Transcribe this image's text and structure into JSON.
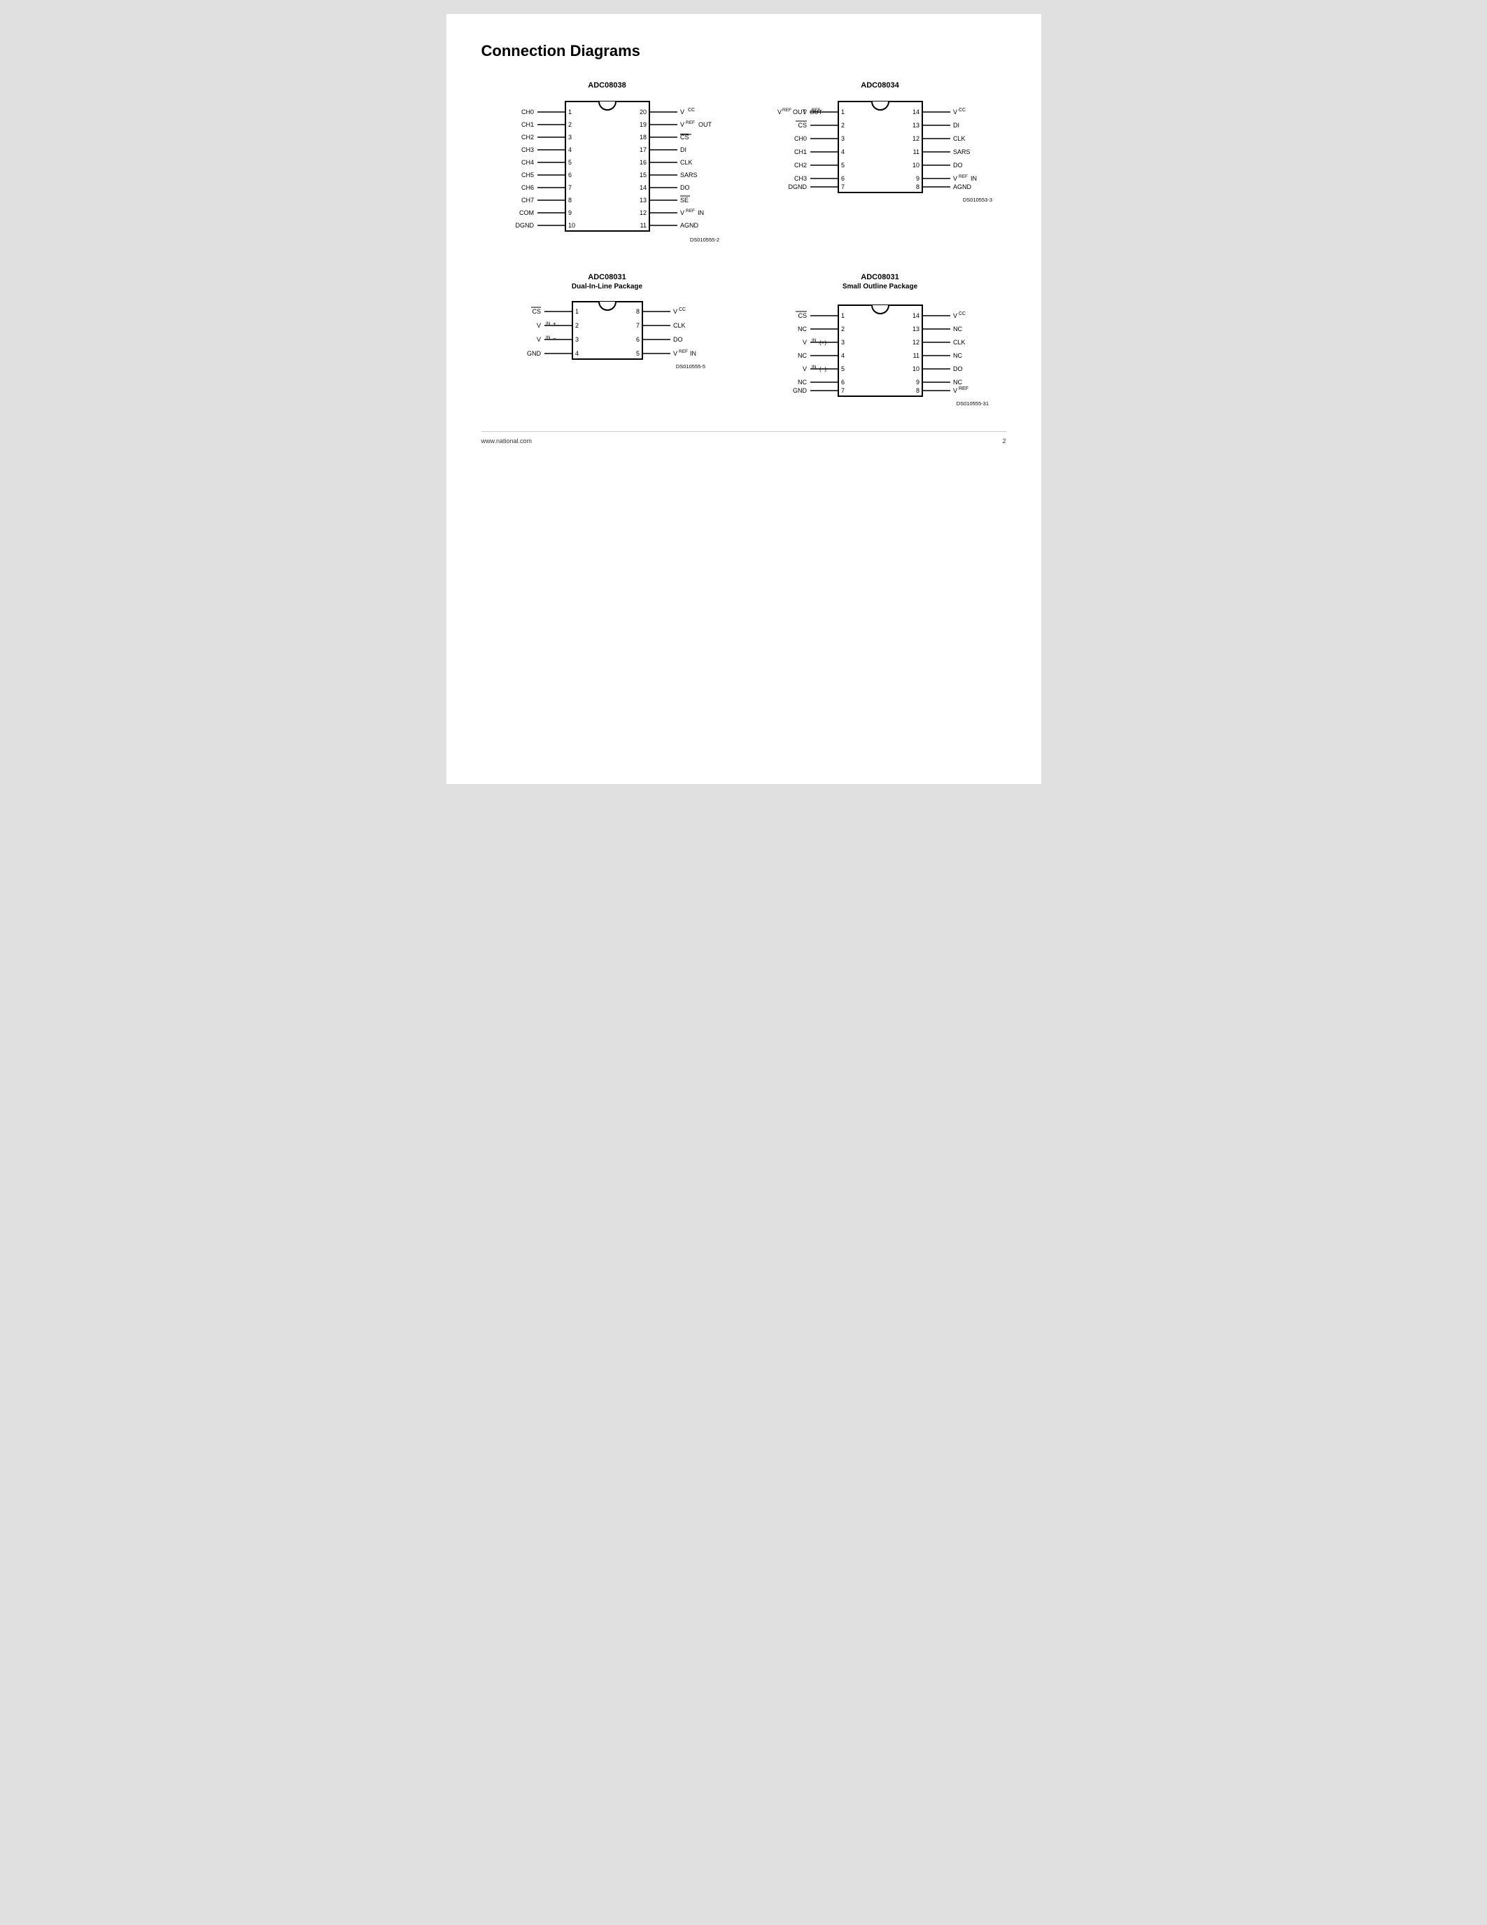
{
  "page": {
    "title": "Connection Diagrams",
    "footer_url": "www.national.com",
    "footer_page": "2"
  },
  "diagrams": [
    {
      "id": "adc08038",
      "title": "ADC08038",
      "subtitle": "",
      "ds_label": "DS010555-2",
      "left_pins": [
        {
          "num": 1,
          "label": "CH0"
        },
        {
          "num": 2,
          "label": "CH1"
        },
        {
          "num": 3,
          "label": "CH2"
        },
        {
          "num": 4,
          "label": "CH3"
        },
        {
          "num": 5,
          "label": "CH4"
        },
        {
          "num": 6,
          "label": "CH5"
        },
        {
          "num": 7,
          "label": "CH6"
        },
        {
          "num": 8,
          "label": "CH7"
        },
        {
          "num": 9,
          "label": "COM"
        },
        {
          "num": 10,
          "label": "DGND"
        }
      ],
      "right_pins": [
        {
          "num": 20,
          "label": "VCC",
          "special": "vcc"
        },
        {
          "num": 19,
          "label": "VREF OUT",
          "special": "vref_out"
        },
        {
          "num": 18,
          "label": "CS",
          "special": "cs_bar"
        },
        {
          "num": 17,
          "label": "DI"
        },
        {
          "num": 16,
          "label": "CLK"
        },
        {
          "num": 15,
          "label": "SARS"
        },
        {
          "num": 14,
          "label": "DO"
        },
        {
          "num": 13,
          "label": "SE",
          "special": "se_bar"
        },
        {
          "num": 12,
          "label": "VREF IN",
          "special": "vref_in"
        },
        {
          "num": 11,
          "label": "AGND"
        }
      ]
    },
    {
      "id": "adc08034",
      "title": "ADC08034",
      "subtitle": "",
      "ds_label": "DS010553-3",
      "left_pins": [
        {
          "num": 1,
          "label": "VREF OUT",
          "special": "vref_out"
        },
        {
          "num": 2,
          "label": "CS",
          "special": "cs_bar"
        },
        {
          "num": 3,
          "label": "CH0"
        },
        {
          "num": 4,
          "label": "CH1"
        },
        {
          "num": 5,
          "label": "CH2"
        },
        {
          "num": 6,
          "label": "CH3"
        },
        {
          "num": 7,
          "label": "DGND"
        }
      ],
      "right_pins": [
        {
          "num": 14,
          "label": "VCC",
          "special": "vcc"
        },
        {
          "num": 13,
          "label": "DI"
        },
        {
          "num": 12,
          "label": "CLK"
        },
        {
          "num": 11,
          "label": "SARS"
        },
        {
          "num": 10,
          "label": "DO"
        },
        {
          "num": 9,
          "label": "VREF IN",
          "special": "vref_in"
        },
        {
          "num": 8,
          "label": "AGND"
        }
      ]
    },
    {
      "id": "adc08031_dil",
      "title": "ADC08031",
      "subtitle": "Dual-In-Line Package",
      "ds_label": "DS010555-5",
      "left_pins": [
        {
          "num": 1,
          "label": "CS",
          "special": "cs_bar"
        },
        {
          "num": 2,
          "label": "VIN+",
          "special": "vin_plus"
        },
        {
          "num": 3,
          "label": "VIN-",
          "special": "vin_minus"
        },
        {
          "num": 4,
          "label": "GND"
        }
      ],
      "right_pins": [
        {
          "num": 8,
          "label": "VCC",
          "special": "vcc"
        },
        {
          "num": 7,
          "label": "CLK"
        },
        {
          "num": 6,
          "label": "DO"
        },
        {
          "num": 5,
          "label": "VREF IN",
          "special": "vref_in"
        }
      ]
    },
    {
      "id": "adc08031_so",
      "title": "ADC08031",
      "subtitle": "Small Outline Package",
      "ds_label": "DS010555-31",
      "left_pins": [
        {
          "num": 1,
          "label": "CS",
          "special": "cs_bar"
        },
        {
          "num": 2,
          "label": "NC"
        },
        {
          "num": 3,
          "label": "VIN(+)",
          "special": "vin_plus_so"
        },
        {
          "num": 4,
          "label": "NC"
        },
        {
          "num": 5,
          "label": "VIN(-)",
          "special": "vin_minus_so"
        },
        {
          "num": 6,
          "label": "NC"
        },
        {
          "num": 7,
          "label": "GND"
        }
      ],
      "right_pins": [
        {
          "num": 14,
          "label": "VCC",
          "special": "vcc"
        },
        {
          "num": 13,
          "label": "NC"
        },
        {
          "num": 12,
          "label": "CLK"
        },
        {
          "num": 11,
          "label": "NC"
        },
        {
          "num": 10,
          "label": "DO"
        },
        {
          "num": 9,
          "label": "NC"
        },
        {
          "num": 8,
          "label": "VREF",
          "special": "vref_only"
        }
      ]
    }
  ]
}
